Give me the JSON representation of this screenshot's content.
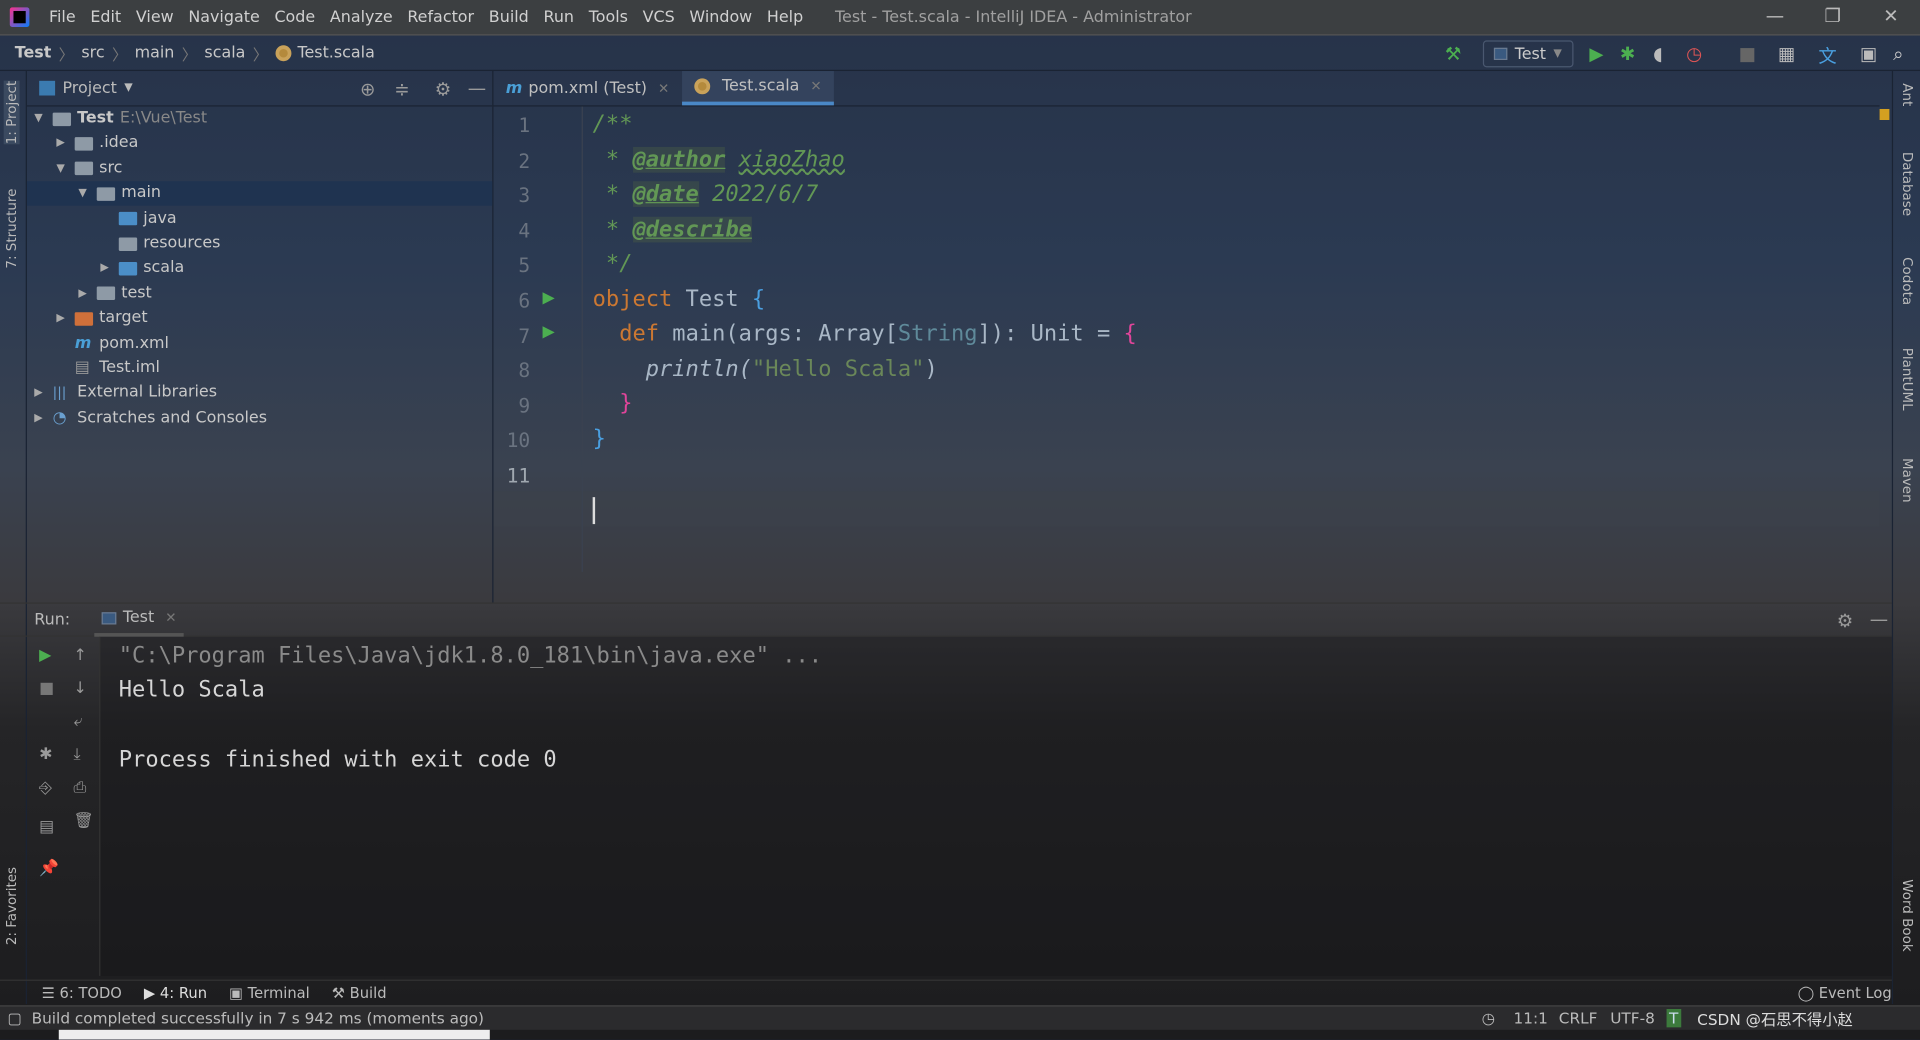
{
  "window": {
    "title": "Test - Test.scala - IntelliJ IDEA - Administrator"
  },
  "menu": [
    "File",
    "Edit",
    "View",
    "Navigate",
    "Code",
    "Analyze",
    "Refactor",
    "Build",
    "Run",
    "Tools",
    "VCS",
    "Window",
    "Help"
  ],
  "breadcrumb": [
    "Test",
    "src",
    "main",
    "scala",
    "Test.scala"
  ],
  "toolbar": {
    "run_config": "Test"
  },
  "left_strip": {
    "project": "1: Project",
    "structure": "7: Structure",
    "favorites": "2: Favorites"
  },
  "right_strip": [
    "Ant",
    "Database",
    "Codota",
    "PlantUML",
    "Maven",
    "Word Book"
  ],
  "project": {
    "title": "Project",
    "tree": [
      {
        "label": "Test",
        "path": "E:\\Vue\\Test",
        "depth": 0,
        "expanded": true,
        "icon": "folder"
      },
      {
        "label": ".idea",
        "depth": 1,
        "expanded": false,
        "icon": "folder"
      },
      {
        "label": "src",
        "depth": 1,
        "expanded": true,
        "icon": "folder"
      },
      {
        "label": "main",
        "depth": 2,
        "expanded": true,
        "icon": "folder",
        "selected": true
      },
      {
        "label": "java",
        "depth": 3,
        "icon": "folder-blue"
      },
      {
        "label": "resources",
        "depth": 3,
        "icon": "folder-resources"
      },
      {
        "label": "scala",
        "depth": 3,
        "expanded": false,
        "icon": "folder-blue"
      },
      {
        "label": "test",
        "depth": 2,
        "expanded": false,
        "icon": "folder"
      },
      {
        "label": "target",
        "depth": 1,
        "expanded": false,
        "icon": "folder-orange"
      },
      {
        "label": "pom.xml",
        "depth": 1,
        "icon": "maven-file"
      },
      {
        "label": "Test.iml",
        "depth": 1,
        "icon": "iml-file"
      },
      {
        "label": "External Libraries",
        "depth": 0,
        "expanded": false,
        "icon": "library"
      },
      {
        "label": "Scratches and Consoles",
        "depth": 0,
        "expanded": false,
        "icon": "scratches"
      }
    ]
  },
  "editor": {
    "tabs": [
      {
        "label": "pom.xml (Test)",
        "active": false
      },
      {
        "label": "Test.scala",
        "active": true
      }
    ],
    "line_numbers": [
      "1",
      "2",
      "3",
      "4",
      "5",
      "6",
      "7",
      "8",
      "9",
      "10",
      "11"
    ],
    "code": {
      "l1": "/**",
      "l2_tag": "@author",
      "l2_val": "xiaoZhao",
      "l3_tag": "@date",
      "l3_val": "2022/6/7",
      "l4_tag": "@describe",
      "l5": " */",
      "object_kw": "object",
      "object_name": " Test ",
      "def_kw": "def",
      "main_sig": " main(args: Array[",
      "string_type": "String",
      "sig_end": "]): Unit = ",
      "println": "println(",
      "hello": "\"Hello Scala\"",
      "paren": ")"
    }
  },
  "run": {
    "label": "Run:",
    "tab": "Test",
    "console": [
      "\"C:\\Program Files\\Java\\jdk1.8.0_181\\bin\\java.exe\" ...",
      "Hello Scala",
      "",
      "Process finished with exit code 0"
    ]
  },
  "tool_tabs": [
    "6: TODO",
    "4: Run",
    "Terminal",
    "Build"
  ],
  "event_log": "Event Log",
  "status": {
    "message": "Build completed successfully in 7 s 942 ms (moments ago)",
    "position": "11:1",
    "line_sep": "CRLF",
    "encoding": "UTF-8",
    "watermark": "CSDN @石思不得小赵"
  }
}
